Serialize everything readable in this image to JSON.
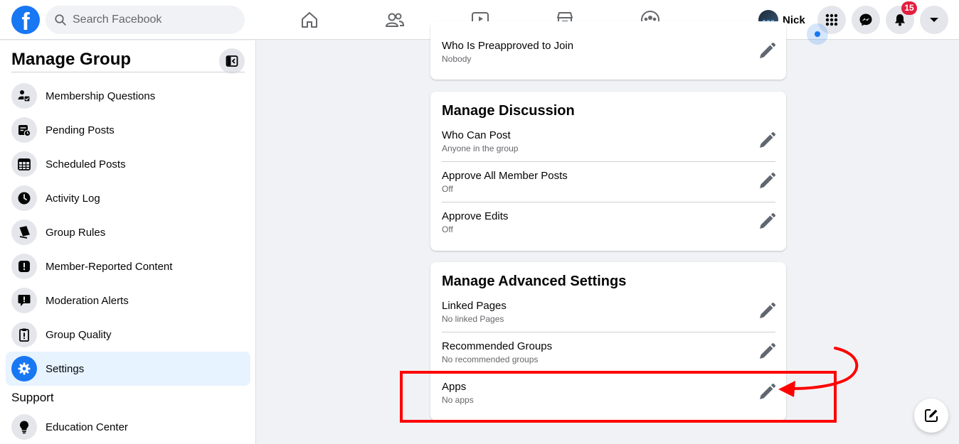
{
  "header": {
    "logo": "f",
    "search_placeholder": "Search Facebook",
    "nav_icons": [
      "home-icon",
      "friends-icon",
      "watch-icon",
      "marketplace-icon",
      "groups-icon"
    ],
    "profile_name": "Nick",
    "notifications_count": "15"
  },
  "sidebar": {
    "title": "Manage Group",
    "items": [
      {
        "label": "Membership Questions",
        "icon": "membership-questions-icon"
      },
      {
        "label": "Pending Posts",
        "icon": "pending-posts-icon"
      },
      {
        "label": "Scheduled Posts",
        "icon": "calendar-icon"
      },
      {
        "label": "Activity Log",
        "icon": "clock-icon"
      },
      {
        "label": "Group Rules",
        "icon": "book-icon"
      },
      {
        "label": "Member-Reported Content",
        "icon": "alert-icon"
      },
      {
        "label": "Moderation Alerts",
        "icon": "speech-alert-icon"
      },
      {
        "label": "Group Quality",
        "icon": "clipboard-icon"
      },
      {
        "label": "Settings",
        "icon": "gear-icon",
        "active": true
      }
    ],
    "support_heading": "Support",
    "support_items": [
      {
        "label": "Education Center",
        "icon": "lightbulb-icon"
      }
    ]
  },
  "cards": {
    "membership": {
      "rows": [
        {
          "title": "Who Is Preapproved to Join",
          "sub": "Nobody"
        }
      ]
    },
    "discussion": {
      "title": "Manage Discussion",
      "rows": [
        {
          "title": "Who Can Post",
          "sub": "Anyone in the group"
        },
        {
          "title": "Approve All Member Posts",
          "sub": "Off"
        },
        {
          "title": "Approve Edits",
          "sub": "Off"
        }
      ]
    },
    "advanced": {
      "title": "Manage Advanced Settings",
      "rows": [
        {
          "title": "Linked Pages",
          "sub": "No linked Pages"
        },
        {
          "title": "Recommended Groups",
          "sub": "No recommended groups"
        },
        {
          "title": "Apps",
          "sub": "No apps"
        }
      ]
    }
  },
  "colors": {
    "brand": "#1877f2",
    "annotation": "#ff0000",
    "badge": "#e41e3f"
  }
}
